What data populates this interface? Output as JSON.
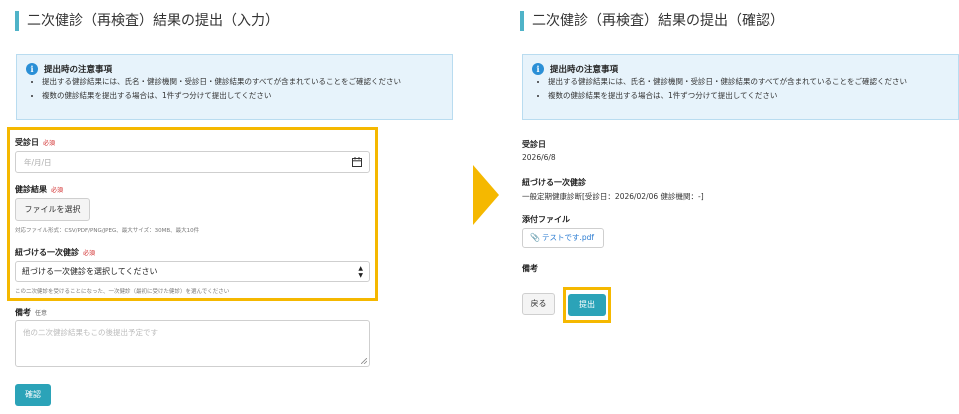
{
  "input_panel": {
    "title": "二次健診（再検査）結果の提出（入力）",
    "notice": {
      "heading": "提出時の注意事項",
      "items": [
        "提出する健診結果には、氏名・健診機関・受診日・健診結果のすべてが含まれていることをご確認ください",
        "複数の健診結果を提出する場合は、1件ずつ分けて提出してください"
      ]
    },
    "visit_date": {
      "label": "受診日",
      "required": "必須",
      "placeholder": "年/月/日"
    },
    "result_file": {
      "label": "健診結果",
      "required": "必須",
      "button": "ファイルを選択",
      "hint": "対応ファイル形式：CSV/PDF/PNG/JPEG、最大サイズ：30MB、最大10件"
    },
    "linked_exam": {
      "label": "紐づける一次健診",
      "required": "必須",
      "selected": "紐づける一次健診を選択してください",
      "hint": "この二次健診を受けることになった、一次健診（最初に受けた健診）を選んでください"
    },
    "remarks": {
      "label": "備考",
      "optional": "任意",
      "placeholder": "他の二次健診結果もこの後提出予定です"
    },
    "confirm_button": "確認"
  },
  "confirm_panel": {
    "title": "二次健診（再検査）結果の提出（確認）",
    "notice": {
      "heading": "提出時の注意事項",
      "items": [
        "提出する健診結果には、氏名・健診機関・受診日・健診結果のすべてが含まれていることをご確認ください",
        "複数の健診結果を提出する場合は、1件ずつ分けて提出してください"
      ]
    },
    "visit_date": {
      "label": "受診日",
      "value": "2026/6/8"
    },
    "linked_exam": {
      "label": "紐づける一次健診",
      "value": "一般定期健康診断[受診日：2026/02/06 健診機関：-]"
    },
    "attachment": {
      "label": "添付ファイル",
      "file_name": "テストです.pdf"
    },
    "remarks": {
      "label": "備考"
    },
    "back_button": "戻る",
    "submit_button": "提出"
  },
  "colors": {
    "accent": "#2ba3b8",
    "highlight": "#f5b800",
    "notice_bg": "#e7f3fb",
    "required": "#d02626"
  }
}
